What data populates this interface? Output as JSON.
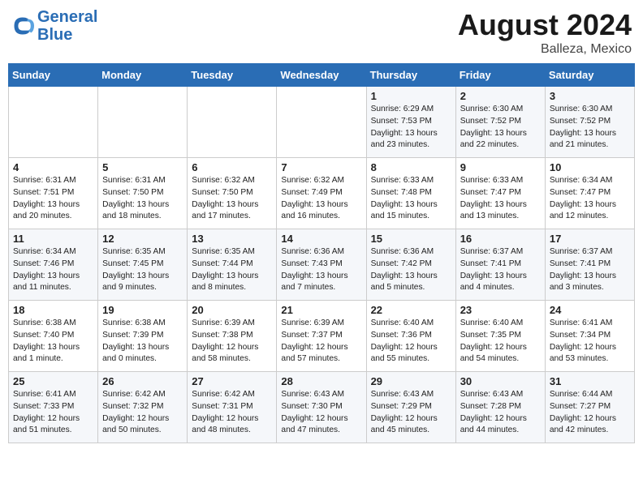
{
  "header": {
    "logo_line1": "General",
    "logo_line2": "Blue",
    "month_year": "August 2024",
    "location": "Balleza, Mexico"
  },
  "days_of_week": [
    "Sunday",
    "Monday",
    "Tuesday",
    "Wednesday",
    "Thursday",
    "Friday",
    "Saturday"
  ],
  "weeks": [
    [
      {
        "day": "",
        "info": ""
      },
      {
        "day": "",
        "info": ""
      },
      {
        "day": "",
        "info": ""
      },
      {
        "day": "",
        "info": ""
      },
      {
        "day": "1",
        "info": "Sunrise: 6:29 AM\nSunset: 7:53 PM\nDaylight: 13 hours\nand 23 minutes."
      },
      {
        "day": "2",
        "info": "Sunrise: 6:30 AM\nSunset: 7:52 PM\nDaylight: 13 hours\nand 22 minutes."
      },
      {
        "day": "3",
        "info": "Sunrise: 6:30 AM\nSunset: 7:52 PM\nDaylight: 13 hours\nand 21 minutes."
      }
    ],
    [
      {
        "day": "4",
        "info": "Sunrise: 6:31 AM\nSunset: 7:51 PM\nDaylight: 13 hours\nand 20 minutes."
      },
      {
        "day": "5",
        "info": "Sunrise: 6:31 AM\nSunset: 7:50 PM\nDaylight: 13 hours\nand 18 minutes."
      },
      {
        "day": "6",
        "info": "Sunrise: 6:32 AM\nSunset: 7:50 PM\nDaylight: 13 hours\nand 17 minutes."
      },
      {
        "day": "7",
        "info": "Sunrise: 6:32 AM\nSunset: 7:49 PM\nDaylight: 13 hours\nand 16 minutes."
      },
      {
        "day": "8",
        "info": "Sunrise: 6:33 AM\nSunset: 7:48 PM\nDaylight: 13 hours\nand 15 minutes."
      },
      {
        "day": "9",
        "info": "Sunrise: 6:33 AM\nSunset: 7:47 PM\nDaylight: 13 hours\nand 13 minutes."
      },
      {
        "day": "10",
        "info": "Sunrise: 6:34 AM\nSunset: 7:47 PM\nDaylight: 13 hours\nand 12 minutes."
      }
    ],
    [
      {
        "day": "11",
        "info": "Sunrise: 6:34 AM\nSunset: 7:46 PM\nDaylight: 13 hours\nand 11 minutes."
      },
      {
        "day": "12",
        "info": "Sunrise: 6:35 AM\nSunset: 7:45 PM\nDaylight: 13 hours\nand 9 minutes."
      },
      {
        "day": "13",
        "info": "Sunrise: 6:35 AM\nSunset: 7:44 PM\nDaylight: 13 hours\nand 8 minutes."
      },
      {
        "day": "14",
        "info": "Sunrise: 6:36 AM\nSunset: 7:43 PM\nDaylight: 13 hours\nand 7 minutes."
      },
      {
        "day": "15",
        "info": "Sunrise: 6:36 AM\nSunset: 7:42 PM\nDaylight: 13 hours\nand 5 minutes."
      },
      {
        "day": "16",
        "info": "Sunrise: 6:37 AM\nSunset: 7:41 PM\nDaylight: 13 hours\nand 4 minutes."
      },
      {
        "day": "17",
        "info": "Sunrise: 6:37 AM\nSunset: 7:41 PM\nDaylight: 13 hours\nand 3 minutes."
      }
    ],
    [
      {
        "day": "18",
        "info": "Sunrise: 6:38 AM\nSunset: 7:40 PM\nDaylight: 13 hours\nand 1 minute."
      },
      {
        "day": "19",
        "info": "Sunrise: 6:38 AM\nSunset: 7:39 PM\nDaylight: 13 hours\nand 0 minutes."
      },
      {
        "day": "20",
        "info": "Sunrise: 6:39 AM\nSunset: 7:38 PM\nDaylight: 12 hours\nand 58 minutes."
      },
      {
        "day": "21",
        "info": "Sunrise: 6:39 AM\nSunset: 7:37 PM\nDaylight: 12 hours\nand 57 minutes."
      },
      {
        "day": "22",
        "info": "Sunrise: 6:40 AM\nSunset: 7:36 PM\nDaylight: 12 hours\nand 55 minutes."
      },
      {
        "day": "23",
        "info": "Sunrise: 6:40 AM\nSunset: 7:35 PM\nDaylight: 12 hours\nand 54 minutes."
      },
      {
        "day": "24",
        "info": "Sunrise: 6:41 AM\nSunset: 7:34 PM\nDaylight: 12 hours\nand 53 minutes."
      }
    ],
    [
      {
        "day": "25",
        "info": "Sunrise: 6:41 AM\nSunset: 7:33 PM\nDaylight: 12 hours\nand 51 minutes."
      },
      {
        "day": "26",
        "info": "Sunrise: 6:42 AM\nSunset: 7:32 PM\nDaylight: 12 hours\nand 50 minutes."
      },
      {
        "day": "27",
        "info": "Sunrise: 6:42 AM\nSunset: 7:31 PM\nDaylight: 12 hours\nand 48 minutes."
      },
      {
        "day": "28",
        "info": "Sunrise: 6:43 AM\nSunset: 7:30 PM\nDaylight: 12 hours\nand 47 minutes."
      },
      {
        "day": "29",
        "info": "Sunrise: 6:43 AM\nSunset: 7:29 PM\nDaylight: 12 hours\nand 45 minutes."
      },
      {
        "day": "30",
        "info": "Sunrise: 6:43 AM\nSunset: 7:28 PM\nDaylight: 12 hours\nand 44 minutes."
      },
      {
        "day": "31",
        "info": "Sunrise: 6:44 AM\nSunset: 7:27 PM\nDaylight: 12 hours\nand 42 minutes."
      }
    ]
  ]
}
